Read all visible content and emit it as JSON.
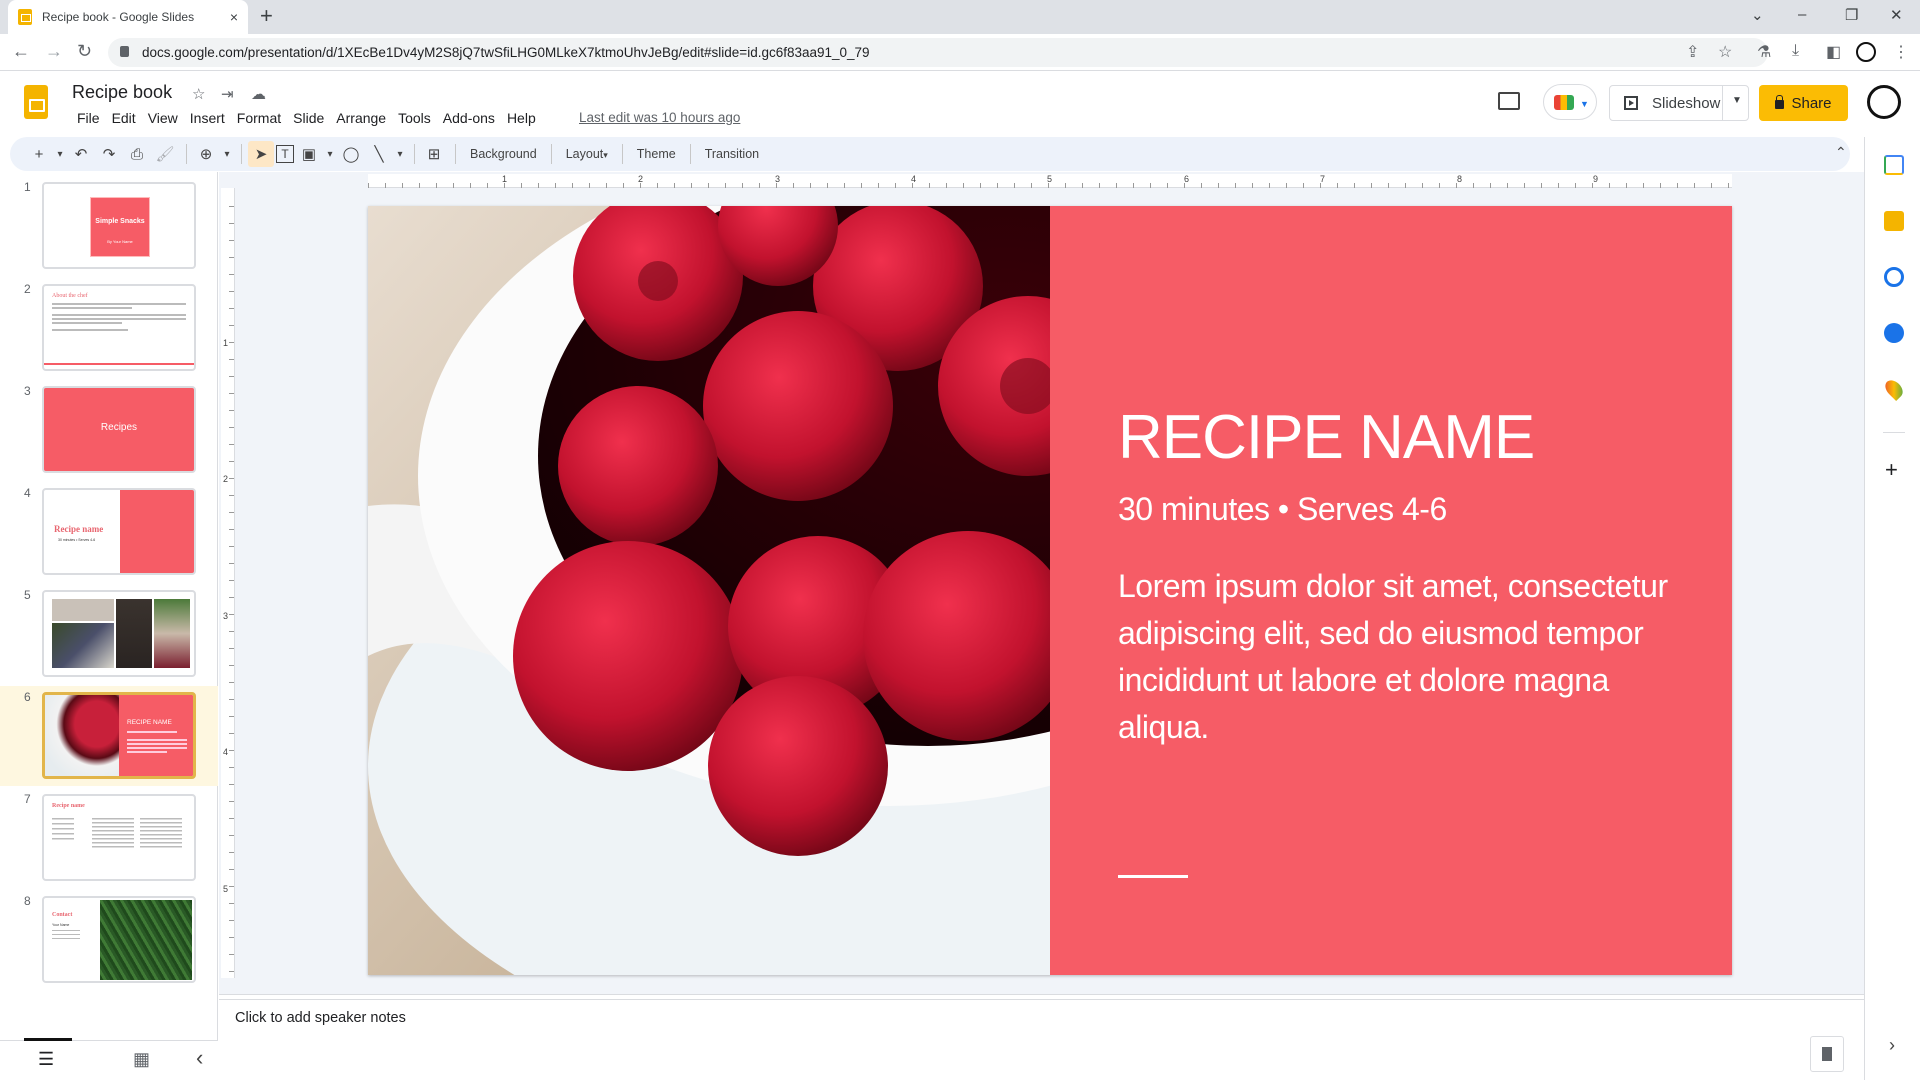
{
  "browser": {
    "tab_title": "Recipe book - Google Slides",
    "tab_close": "×",
    "new_tab": "+",
    "url": "docs.google.com/presentation/d/1XEcBe1Dv4yM2S8jQ7twSfiLHG0MLkeX7ktmoUhvJeBg/edit#slide=id.gc6f83aa91_0_79",
    "window_controls": {
      "tab_search": "⌄",
      "minimize": "–",
      "restore": "❐",
      "close": "✕"
    },
    "nav": {
      "back": "←",
      "forward": "→",
      "reload": "↻"
    },
    "toolbar_icons": {
      "share_page": "⇪",
      "bookmark": "☆",
      "labs": "⚗",
      "download": "⤓",
      "side_panel": "◧",
      "menu": "⋮"
    }
  },
  "header": {
    "doc_title": "Recipe book",
    "star_icon": "☆",
    "move_icon": "⇥",
    "cloud_icon": "☁",
    "menus": [
      "File",
      "Edit",
      "View",
      "Insert",
      "Format",
      "Slide",
      "Arrange",
      "Tools",
      "Add-ons",
      "Help"
    ],
    "last_edit": "Last edit was 10 hours ago",
    "slideshow_label": "Slideshow",
    "share_label": "Share"
  },
  "toolbar": {
    "new_slide": "+",
    "dropdown": "▾",
    "undo": "↶",
    "redo": "↷",
    "print": "⎙",
    "paint_format": "🖌",
    "zoom": "⊕",
    "select": "➤",
    "textbox": "T",
    "image": "▣",
    "shape": "◯",
    "line": "╲",
    "comment": "⊞",
    "background_label": "Background",
    "layout_label": "Layout",
    "theme_label": "Theme",
    "transition_label": "Transition",
    "collapse": "⌃"
  },
  "ruler": {
    "h_marks": [
      "1",
      "2",
      "3",
      "4",
      "5",
      "6",
      "7",
      "8",
      "9"
    ],
    "v_marks": [
      "1",
      "2",
      "3",
      "4",
      "5"
    ]
  },
  "filmstrip": {
    "slides": [
      {
        "num": "1",
        "title": "Simple Snacks",
        "subtitle": "By Your Name"
      },
      {
        "num": "2",
        "title": "About the chef"
      },
      {
        "num": "3",
        "title": "Recipes"
      },
      {
        "num": "4",
        "title": "Recipe name",
        "subtitle": "30 minutes • Serves 4-6"
      },
      {
        "num": "5",
        "title": ""
      },
      {
        "num": "6",
        "title": "RECIPE NAME",
        "selected": true
      },
      {
        "num": "7",
        "title": "Recipe name"
      },
      {
        "num": "8",
        "title": "Contact",
        "subtitle": "Your Name"
      }
    ],
    "view_list_icon": "☰",
    "view_grid_icon": "▦",
    "collapse_icon": "‹"
  },
  "slide": {
    "title": "RECIPE NAME",
    "subtitle": "30 minutes • Serves 4-6",
    "body": "Lorem ipsum dolor sit amet, consectetur adipiscing elit, sed do eiusmod tempor incididunt ut labore et dolore magna aliqua.",
    "accent_color": "#f65c66"
  },
  "notes": {
    "placeholder": "Click to add speaker notes"
  },
  "side_panel": {
    "add": "+",
    "expand": "›"
  }
}
